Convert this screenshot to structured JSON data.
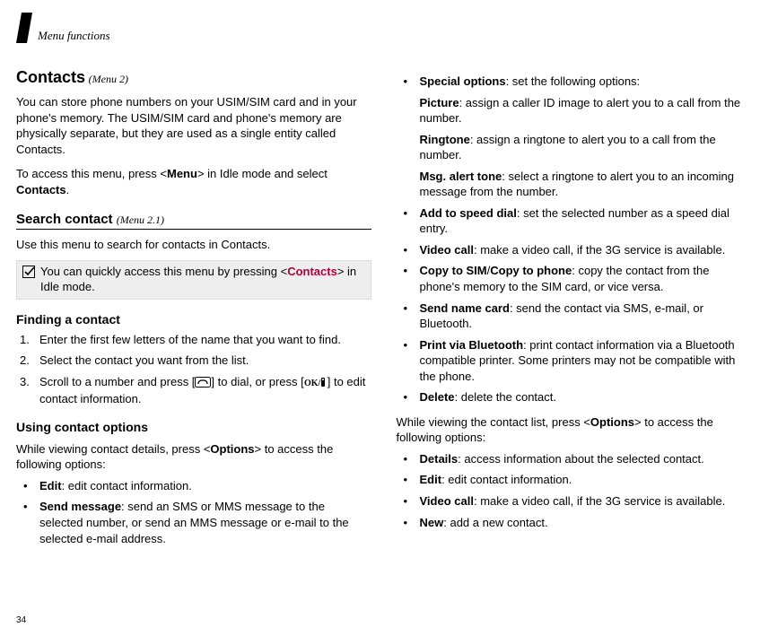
{
  "header": {
    "title": "Menu functions"
  },
  "left": {
    "title": "Contacts",
    "title_ref": "(Menu 2)",
    "intro1": "You can store phone numbers on your USIM/SIM card and in your phone's memory. The USIM/SIM card and phone's memory are physically separate, but they are used as a single entity called Contacts.",
    "intro2_pre": "To access this menu, press <",
    "intro2_menu": "Menu",
    "intro2_mid": "> in Idle mode and select ",
    "intro2_contacts": "Contacts",
    "intro2_post": ".",
    "search_head": "Search contact",
    "search_ref": "(Menu 2.1)",
    "search_desc": "Use this menu to search for contacts in Contacts.",
    "tip_pre": "You can quickly access this menu by pressing <",
    "tip_link": "Contacts",
    "tip_post": "> in Idle mode.",
    "finding_head": "Finding a contact",
    "step1": "Enter the first few letters of the name that you want to find.",
    "step2": "Select the contact you want from the list.",
    "step3_pre": "Scroll to a number and press [",
    "step3_mid": "] to dial, or press [",
    "step3_post": "] to edit contact information.",
    "using_head": "Using contact options",
    "using_para_pre": "While viewing contact details, press <",
    "using_para_opts": "Options",
    "using_para_post": "> to access the following options:",
    "opt_edit_label": "Edit",
    "opt_edit_desc": ": edit contact information.",
    "opt_send_label": "Send message",
    "opt_send_desc": ": send an SMS or MMS message to the selected number, or send an MMS message or e-mail to the selected e-mail address."
  },
  "right": {
    "special_label": "Special options",
    "special_desc": ": set the following options:",
    "picture_label": "Picture",
    "picture_desc": ": assign a caller ID image to alert you to a call from the number.",
    "ringtone_label": "Ringtone",
    "ringtone_desc": ": assign a ringtone to alert you to a call from the number.",
    "msg_label": "Msg. alert tone",
    "msg_desc": ": select a ringtone to alert you to an incoming message from the number.",
    "speed_label": "Add to speed dial",
    "speed_desc": ": set the selected number as a speed dial entry.",
    "video_label": "Video call",
    "video_desc": ": make a video call, if the 3G service is available.",
    "copy_label": "Copy to SIM",
    "copy_sep": "/",
    "copy_label2": "Copy to phone",
    "copy_desc": ": copy the contact from the phone's memory to the SIM card, or vice versa.",
    "namecard_label": "Send name card",
    "namecard_desc": ": send the contact via SMS, e-mail, or Bluetooth.",
    "print_label": "Print via Bluetooth",
    "print_desc": ": print contact information via a Bluetooth compatible printer. Some printers may not be compatible with the phone.",
    "delete_label": "Delete",
    "delete_desc": ": delete the contact.",
    "list_para_pre": "While viewing the contact list, press <",
    "list_para_opts": "Options",
    "list_para_post": "> to access the following options:",
    "details_label": "Details",
    "details_desc": ": access information about the selected contact.",
    "edit2_label": "Edit",
    "edit2_desc": ": edit contact information.",
    "video2_label": "Video call",
    "video2_desc": ": make a video call, if the 3G service is available.",
    "new_label": "New",
    "new_desc": ": add a new contact."
  },
  "page_number": "34"
}
